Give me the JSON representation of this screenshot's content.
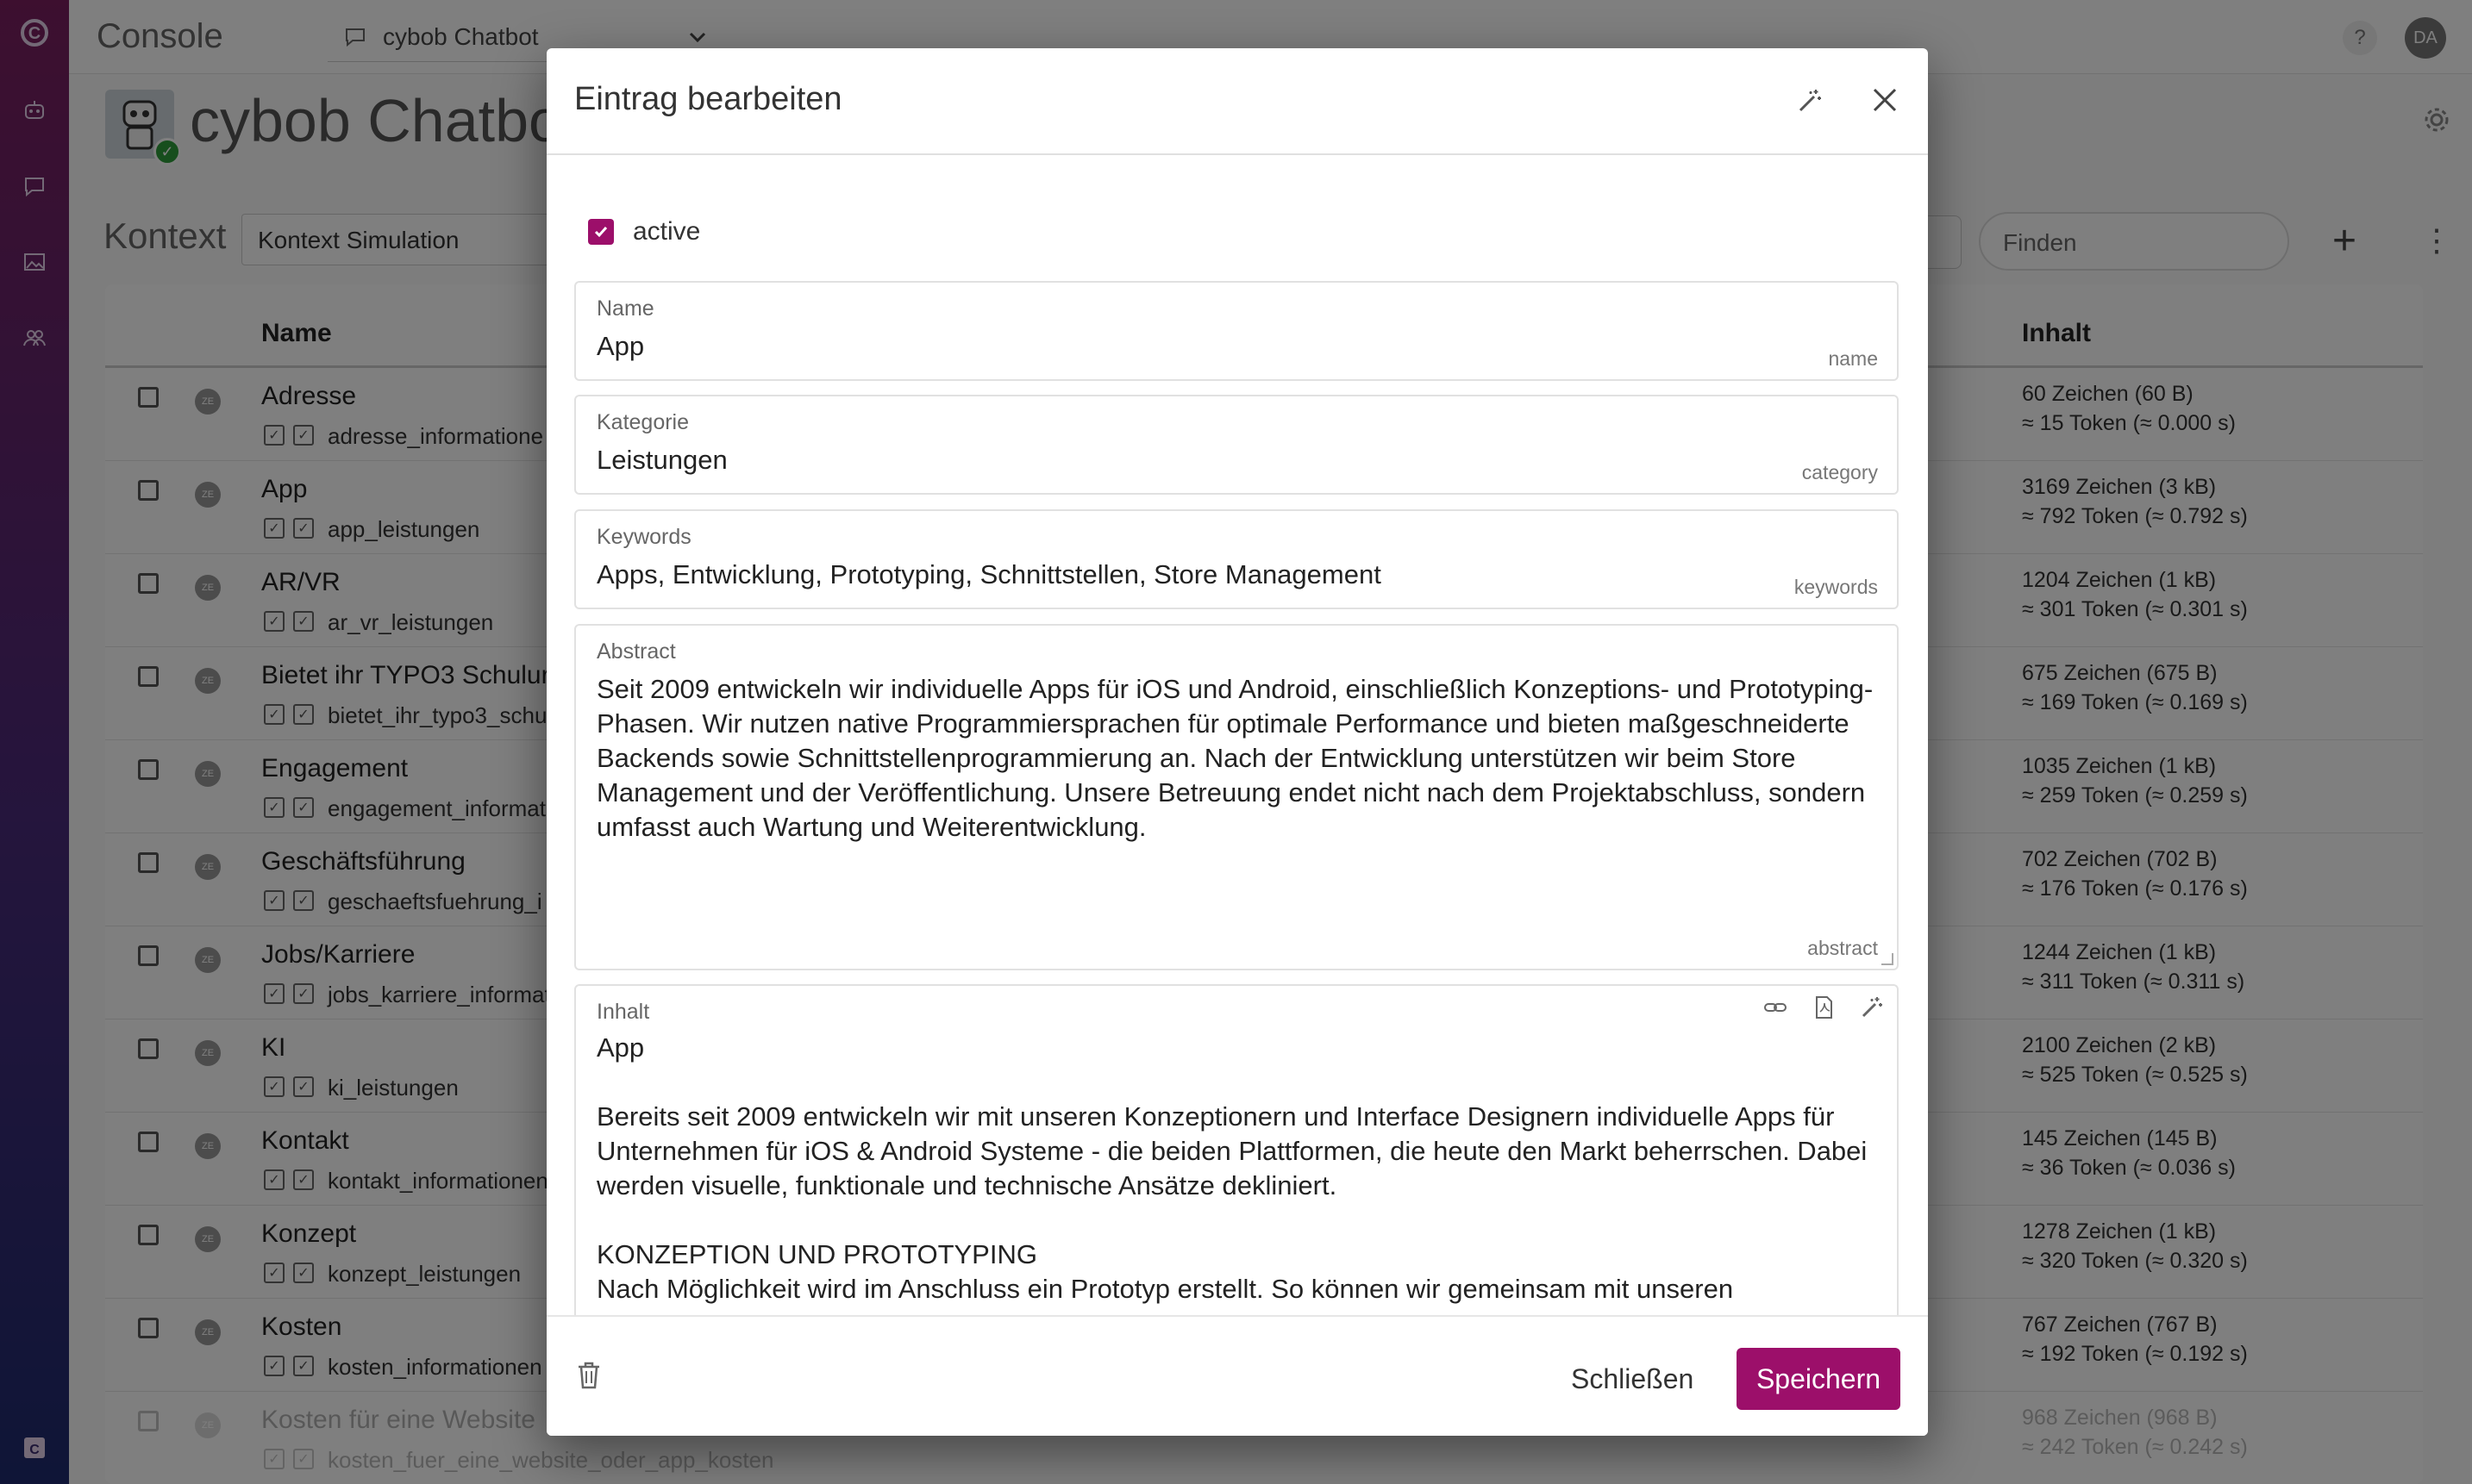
{
  "app": {
    "title": "Console",
    "chatbot_select": "cybob Chatbot",
    "help": "?",
    "user_initials": "DA",
    "bot_title": "cybob Chatbot",
    "kontext_label": "Kontext",
    "kontext_select": "Kontext Simulation",
    "search_placeholder": "Finden"
  },
  "table": {
    "col_name": "Name",
    "col_inhalt": "Inhalt",
    "rows": [
      {
        "name": "Adresse",
        "slug": "adresse_informatione",
        "chars": "60 Zeichen (60 B)",
        "tokens": "≈ 15 Token (≈ 0.000 s)"
      },
      {
        "name": "App",
        "slug": "app_leistungen",
        "chars": "3169 Zeichen (3 kB)",
        "tokens": "≈ 792 Token (≈ 0.792 s)"
      },
      {
        "name": "AR/VR",
        "slug": "ar_vr_leistungen",
        "chars": "1204 Zeichen (1 kB)",
        "tokens": "≈ 301 Token (≈ 0.301 s)"
      },
      {
        "name": "Bietet ihr TYPO3 Schulur",
        "slug": "bietet_ihr_typo3_schu",
        "chars": "675 Zeichen (675 B)",
        "tokens": "≈ 169 Token (≈ 0.169 s)"
      },
      {
        "name": "Engagement",
        "slug": "engagement_informat",
        "chars": "1035 Zeichen (1 kB)",
        "tokens": "≈ 259 Token (≈ 0.259 s)"
      },
      {
        "name": "Geschäftsführung",
        "slug": "geschaeftsfuehrung_i",
        "chars": "702 Zeichen (702 B)",
        "tokens": "≈ 176 Token (≈ 0.176 s)"
      },
      {
        "name": "Jobs/Karriere",
        "slug": "jobs_karriere_informat",
        "chars": "1244 Zeichen (1 kB)",
        "tokens": "≈ 311 Token (≈ 0.311 s)"
      },
      {
        "name": "KI",
        "slug": "ki_leistungen",
        "chars": "2100 Zeichen (2 kB)",
        "tokens": "≈ 525 Token (≈ 0.525 s)"
      },
      {
        "name": "Kontakt",
        "slug": "kontakt_informationen",
        "chars": "145 Zeichen (145 B)",
        "tokens": "≈ 36 Token (≈ 0.036 s)"
      },
      {
        "name": "Konzept",
        "slug": "konzept_leistungen",
        "chars": "1278 Zeichen (1 kB)",
        "tokens": "≈ 320 Token (≈ 0.320 s)"
      },
      {
        "name": "Kosten",
        "slug": "kosten_informationen",
        "chars": "767 Zeichen (767 B)",
        "tokens": "≈ 192 Token (≈ 0.192 s)"
      },
      {
        "name": "Kosten für eine Website",
        "slug": "kosten_fuer_eine_website_oder_app_kosten",
        "chars": "968 Zeichen (968 B)",
        "tokens": "≈ 242 Token (≈ 0.242 s)"
      }
    ]
  },
  "dialog": {
    "title": "Eintrag bearbeiten",
    "active_label": "active",
    "name": {
      "label": "Name",
      "value": "App",
      "hint": "name"
    },
    "category": {
      "label": "Kategorie",
      "value": "Leistungen",
      "hint": "category"
    },
    "keywords": {
      "label": "Keywords",
      "value": "Apps, Entwicklung, Prototyping, Schnittstellen, Store Management",
      "hint": "keywords"
    },
    "abstract": {
      "label": "Abstract",
      "value": "Seit 2009 entwickeln wir individuelle Apps für iOS und Android, einschließlich Konzeptions- und Prototyping-Phasen. Wir nutzen native Programmiersprachen für optimale Performance und bieten maßgeschneiderte Backends sowie Schnittstellenprogrammierung an. Nach der Entwicklung unterstützen wir beim Store Management und der Veröffentlichung. Unsere Betreuung endet nicht nach dem Projektabschluss, sondern umfasst auch Wartung und Weiterentwicklung.",
      "hint": "abstract"
    },
    "inhalt": {
      "label": "Inhalt",
      "value": "App\n\nBereits seit 2009 entwickeln wir mit unseren Konzeptionern und Interface Designern individuelle Apps für Unternehmen für iOS & Android Systeme - die beiden Plattformen, die heute den Markt beherrschen. Dabei werden visuelle, funktionale und technische Ansätze dekliniert.\n\nKONZEPTION UND PROTOTYPING\nNach Möglichkeit wird im Anschluss ein Prototyp erstellt. So können wir gemeinsam mit unseren"
    },
    "close_label": "Schließen",
    "save_label": "Speichern"
  },
  "colors": {
    "accent": "#9c0f6a"
  }
}
